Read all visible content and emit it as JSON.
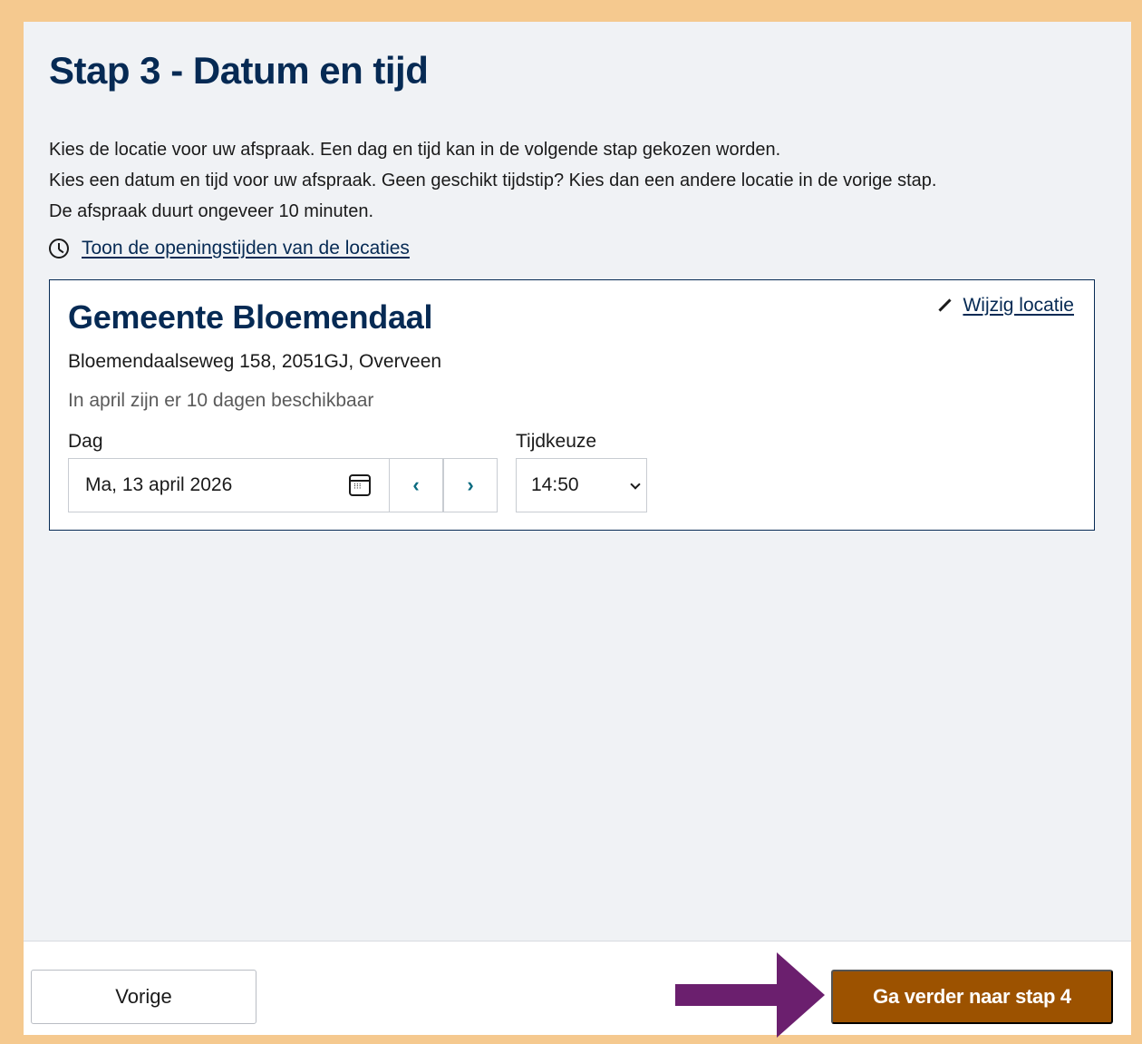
{
  "page": {
    "title": "Stap 3 - Datum en tijd",
    "intro_lines": [
      "Kies de locatie voor uw afspraak. Een dag en tijd kan in de volgende stap gekozen worden.",
      "Kies een datum en tijd voor uw afspraak. Geen geschikt tijdstip? Kies dan een andere locatie in de vorige stap.",
      "De afspraak duurt ongeveer 10 minuten."
    ],
    "hours_link": "Toon de openingstijden van de locaties"
  },
  "location": {
    "name": "Gemeente Bloemendaal",
    "edit_link": "Wijzig locatie",
    "address": "Bloemendaalseweg 158, 2051GJ, Overveen",
    "availability": "In april zijn er 10 dagen beschikbaar",
    "day_label": "Dag",
    "day_value": "Ma, 13 april 2026",
    "prev_glyph": "‹",
    "next_glyph": "›",
    "time_label": "Tijdkeuze",
    "time_value": "14:50"
  },
  "footer": {
    "back_label": "Vorige",
    "next_label": "Ga verder naar stap 4"
  },
  "colors": {
    "frame": "#f5c98f",
    "heading": "#062a54",
    "primary_button": "#9c5200",
    "annotation_arrow": "#6b1f6e",
    "nav_chevron": "#0b6b80"
  },
  "icons": [
    "clock-icon",
    "pencil-icon",
    "calendar-icon",
    "chevron-left-icon",
    "chevron-right-icon",
    "chevron-down-icon",
    "arrow-right-icon"
  ]
}
